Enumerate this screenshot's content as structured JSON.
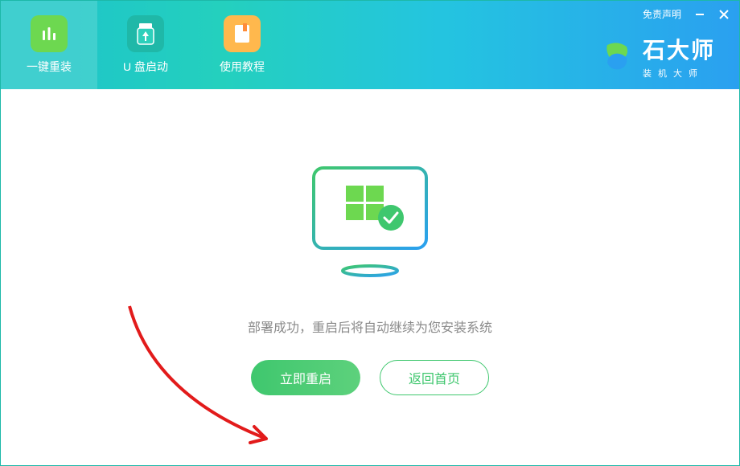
{
  "header": {
    "tabs": [
      {
        "label": "一键重装"
      },
      {
        "label": "U 盘启动"
      },
      {
        "label": "使用教程"
      }
    ],
    "disclaimer": "免责声明"
  },
  "brand": {
    "title": "石大师",
    "subtitle": "装机大师"
  },
  "main": {
    "status_text": "部署成功，重启后将自动继续为您安装系统",
    "restart_label": "立即重启",
    "home_label": "返回首页"
  }
}
